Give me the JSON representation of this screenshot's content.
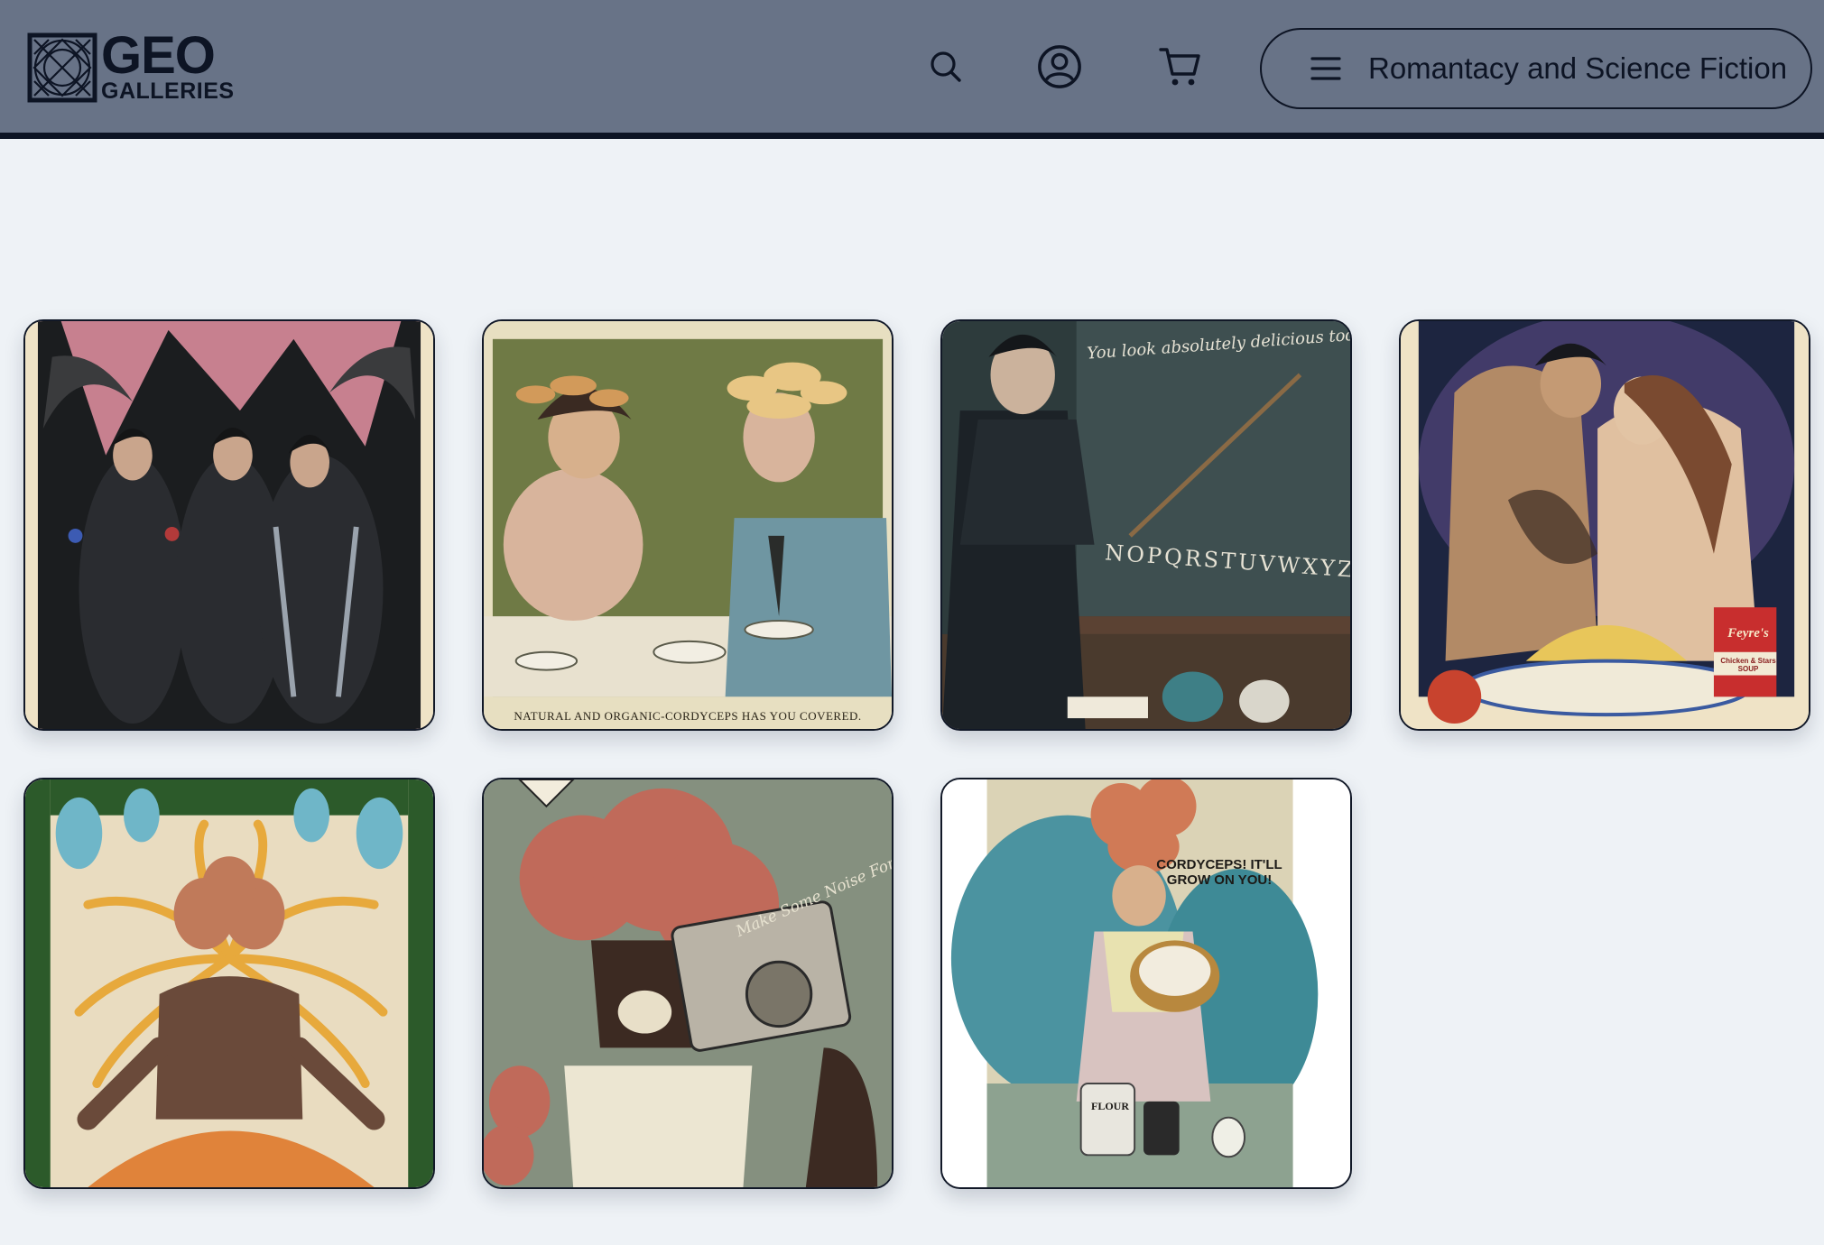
{
  "brand": {
    "line1": "GEO",
    "line2": "GALLERIES",
    "dark": "#0d1424",
    "header_bg": "#687387"
  },
  "header": {
    "icons": [
      "search-icon",
      "account-icon",
      "cart-icon",
      "menu-icon"
    ],
    "menu_label": "Romantacy and Science Fiction"
  },
  "gallery": {
    "artworks": [
      {
        "subject": "winged-brothers",
        "caption": ""
      },
      {
        "subject": "cordyceps-tea-couple",
        "caption": "Natural and organic-cordyceps has you covered."
      },
      {
        "subject": "chalkboard-teacher",
        "caption": "",
        "chalk_text": "You look absolutely delicious today~",
        "alphabet": "NOPQRSTUVWXYZ"
      },
      {
        "subject": "embracing-couple-soup",
        "caption": "",
        "can_brand": "Feyre's",
        "can_label": "Chicken & Stars SOUP"
      },
      {
        "subject": "meditating-clicker",
        "caption": ""
      },
      {
        "subject": "boombox-clicker",
        "caption": "",
        "speech": "Make Some Noise For Cordyceps!"
      },
      {
        "subject": "baking-housewife",
        "caption": "",
        "slogan": "CORDYCEPS! IT'LL GROW ON YOU!",
        "jar_label": "FLOUR"
      }
    ]
  }
}
